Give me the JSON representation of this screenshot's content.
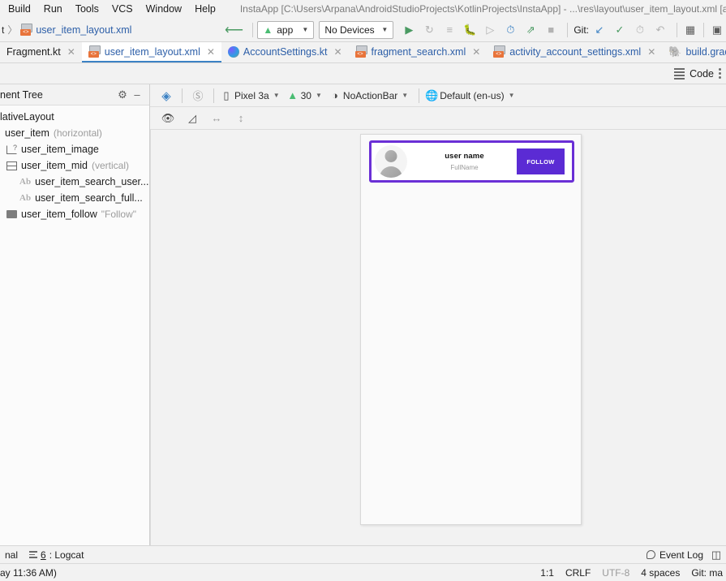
{
  "window": {
    "title": "InstaApp [C:\\Users\\Arpana\\AndroidStudioProjects\\KotlinProjects\\InstaApp] - ...\\res\\layout\\user_item_layout.xml [app]"
  },
  "menubar": {
    "items": [
      {
        "label": "Build"
      },
      {
        "label": "Run"
      },
      {
        "label": "Tools"
      },
      {
        "label": "VCS"
      },
      {
        "label": "Window"
      },
      {
        "label": "Help"
      }
    ]
  },
  "navbar": {
    "crumb_sep": "〉",
    "crumb_prefix": "t",
    "crumb_file": "user_item_layout.xml",
    "file_icon": "xml-file-icon",
    "build_icon": "hammer-icon",
    "module_selector": "app",
    "module_icon": "android-icon",
    "device_selector": "No Devices",
    "run_icon": "run-icon",
    "rerun_icon": "rerun-icon",
    "log_icon": "log-icon",
    "debug_icon": "debug-icon",
    "attach_icon": "attach-debugger-icon",
    "profiler_icon": "profiler-icon",
    "apply_changes_icon": "apply-changes-icon",
    "stop_icon": "stop-icon",
    "git_label": "Git:",
    "update_icon": "update-project-icon",
    "commit_icon": "commit-icon",
    "history_icon": "history-icon",
    "revert_icon": "revert-icon",
    "avd_icon": "device-manager-icon",
    "sdk_icon": "sdk-manager-icon"
  },
  "tabs": [
    {
      "label": "Fragment.kt",
      "icon": "kotlin-file-icon",
      "active": false,
      "closable": true
    },
    {
      "label": "user_item_layout.xml",
      "icon": "xml-file-icon",
      "active": true,
      "closable": true
    },
    {
      "label": "AccountSettings.kt",
      "icon": "kotlin-file-icon",
      "active": false,
      "closable": true
    },
    {
      "label": "fragment_search.xml",
      "icon": "xml-file-icon",
      "active": false,
      "closable": true
    },
    {
      "label": "activity_account_settings.xml",
      "icon": "xml-file-icon",
      "active": false,
      "closable": true
    },
    {
      "label": "build.gradle (:app)",
      "icon": "gradle-file-icon",
      "active": false,
      "closable": false
    }
  ],
  "modebar": {
    "code_label": "Code",
    "code_icon": "code-view-icon",
    "more_icon": "more-options-icon"
  },
  "component_tree": {
    "title": "nent Tree",
    "settings_icon": "gear-icon",
    "minimize_icon": "minimize-icon",
    "nodes": [
      {
        "label": "lativeLayout",
        "hint": "",
        "icon": "layout-icon",
        "indent": 0
      },
      {
        "label": "user_item",
        "hint": "(horizontal)",
        "icon": "linear-layout-icon",
        "indent": 1
      },
      {
        "label": "user_item_image",
        "hint": "",
        "icon": "image-view-icon",
        "indent": 2
      },
      {
        "label": "user_item_mid",
        "hint": "(vertical)",
        "icon": "linear-layout-icon",
        "indent": 2
      },
      {
        "label": "user_item_search_user...",
        "hint": "",
        "icon": "text-view-icon",
        "indent": 3
      },
      {
        "label": "user_item_search_full...",
        "hint": "",
        "icon": "text-view-icon",
        "indent": 3
      },
      {
        "label": "user_item_follow",
        "hint": "\"Follow\"",
        "icon": "button-icon",
        "indent": 2
      }
    ]
  },
  "design_toolbar": {
    "layers_icon": "design-surface-icon",
    "blueprint_icon": "blueprint-toggle-icon",
    "device": "Pixel 3a",
    "device_icon": "device-icon",
    "api": "30",
    "api_icon": "android-api-icon",
    "theme": "NoActionBar",
    "theme_icon": "theme-icon",
    "locale": "Default (en-us)",
    "locale_icon": "locale-globe-icon"
  },
  "design_toolbar2": {
    "eye_icon": "view-options-icon",
    "constraints_icon": "toggle-constraints-icon",
    "hwidth_icon": "horizontal-resize-icon",
    "vheight_icon": "vertical-resize-icon"
  },
  "preview": {
    "card": {
      "user_name": "user name",
      "full_name": "FullName",
      "follow_label": "FOLLOW",
      "avatar_icon": "default-avatar-icon",
      "border_color": "#6a2fd6",
      "button_color": "#5b2bd4"
    }
  },
  "toolwindows": {
    "terminal_label": "nal",
    "logcat_number": "6",
    "logcat_label": ": Logcat",
    "logcat_icon": "logcat-icon",
    "event_log_label": "Event Log",
    "event_log_icon": "event-log-icon",
    "layout_icon": "layout-toggle-icon"
  },
  "statusbar": {
    "left": "ay 11:36 AM)",
    "caret": "1:1",
    "line_sep": "CRLF",
    "encoding": "UTF-8",
    "indent": "4 spaces",
    "branch": "Git: ma"
  }
}
